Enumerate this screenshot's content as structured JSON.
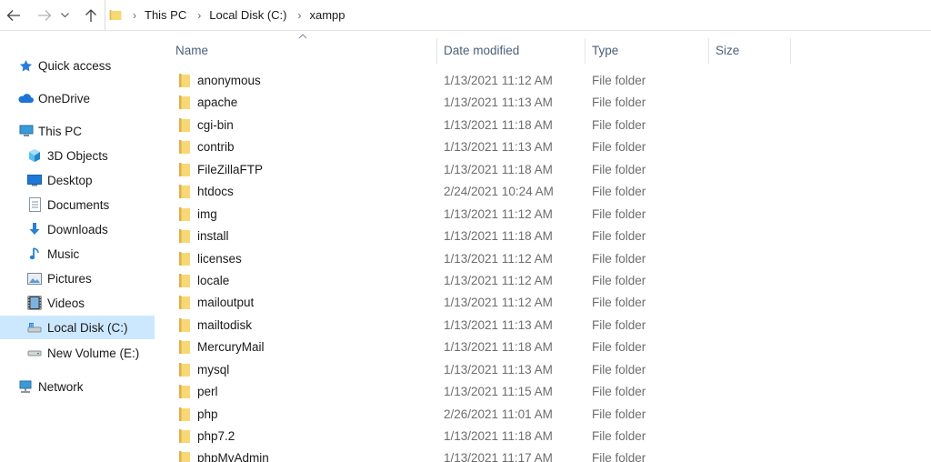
{
  "nav": {
    "back_icon": "back-arrow-icon",
    "forward_icon": "forward-arrow-icon",
    "recent_icon": "chevron-down-icon",
    "up_icon": "up-arrow-icon"
  },
  "address": {
    "crumbs": [
      "This PC",
      "Local Disk (C:)",
      "xampp"
    ]
  },
  "sidebar": {
    "items": [
      {
        "label": "Quick access",
        "icon": "star-icon"
      },
      {
        "label": "OneDrive",
        "icon": "cloud-icon"
      },
      {
        "label": "This PC",
        "icon": "computer-icon"
      },
      {
        "label": "3D Objects",
        "icon": "cube-icon"
      },
      {
        "label": "Desktop",
        "icon": "desktop-icon"
      },
      {
        "label": "Documents",
        "icon": "document-icon"
      },
      {
        "label": "Downloads",
        "icon": "download-icon"
      },
      {
        "label": "Music",
        "icon": "music-icon"
      },
      {
        "label": "Pictures",
        "icon": "picture-icon"
      },
      {
        "label": "Videos",
        "icon": "video-icon"
      },
      {
        "label": "Local Disk (C:)",
        "icon": "drive-icon"
      },
      {
        "label": "New Volume (E:)",
        "icon": "drive-icon"
      },
      {
        "label": "Network",
        "icon": "network-icon"
      }
    ],
    "selected": "Local Disk (C:)"
  },
  "columns": {
    "name": "Name",
    "date": "Date modified",
    "type": "Type",
    "size": "Size"
  },
  "files": [
    {
      "name": "anonymous",
      "date": "1/13/2021 11:12 AM",
      "type": "File folder"
    },
    {
      "name": "apache",
      "date": "1/13/2021 11:13 AM",
      "type": "File folder"
    },
    {
      "name": "cgi-bin",
      "date": "1/13/2021 11:18 AM",
      "type": "File folder"
    },
    {
      "name": "contrib",
      "date": "1/13/2021 11:13 AM",
      "type": "File folder"
    },
    {
      "name": "FileZillaFTP",
      "date": "1/13/2021 11:18 AM",
      "type": "File folder"
    },
    {
      "name": "htdocs",
      "date": "2/24/2021 10:24 AM",
      "type": "File folder"
    },
    {
      "name": "img",
      "date": "1/13/2021 11:12 AM",
      "type": "File folder"
    },
    {
      "name": "install",
      "date": "1/13/2021 11:18 AM",
      "type": "File folder"
    },
    {
      "name": "licenses",
      "date": "1/13/2021 11:12 AM",
      "type": "File folder"
    },
    {
      "name": "locale",
      "date": "1/13/2021 11:12 AM",
      "type": "File folder"
    },
    {
      "name": "mailoutput",
      "date": "1/13/2021 11:12 AM",
      "type": "File folder"
    },
    {
      "name": "mailtodisk",
      "date": "1/13/2021 11:13 AM",
      "type": "File folder"
    },
    {
      "name": "MercuryMail",
      "date": "1/13/2021 11:18 AM",
      "type": "File folder"
    },
    {
      "name": "mysql",
      "date": "1/13/2021 11:13 AM",
      "type": "File folder"
    },
    {
      "name": "perl",
      "date": "1/13/2021 11:15 AM",
      "type": "File folder"
    },
    {
      "name": "php",
      "date": "2/26/2021 11:01 AM",
      "type": "File folder"
    },
    {
      "name": "php7.2",
      "date": "1/13/2021 11:18 AM",
      "type": "File folder"
    },
    {
      "name": "phpMyAdmin",
      "date": "1/13/2021 11:17 AM",
      "type": "File folder"
    }
  ],
  "colors": {
    "folder": "#f8d775",
    "selected_bg": "#cce8ff",
    "header_text": "#4c607a"
  }
}
